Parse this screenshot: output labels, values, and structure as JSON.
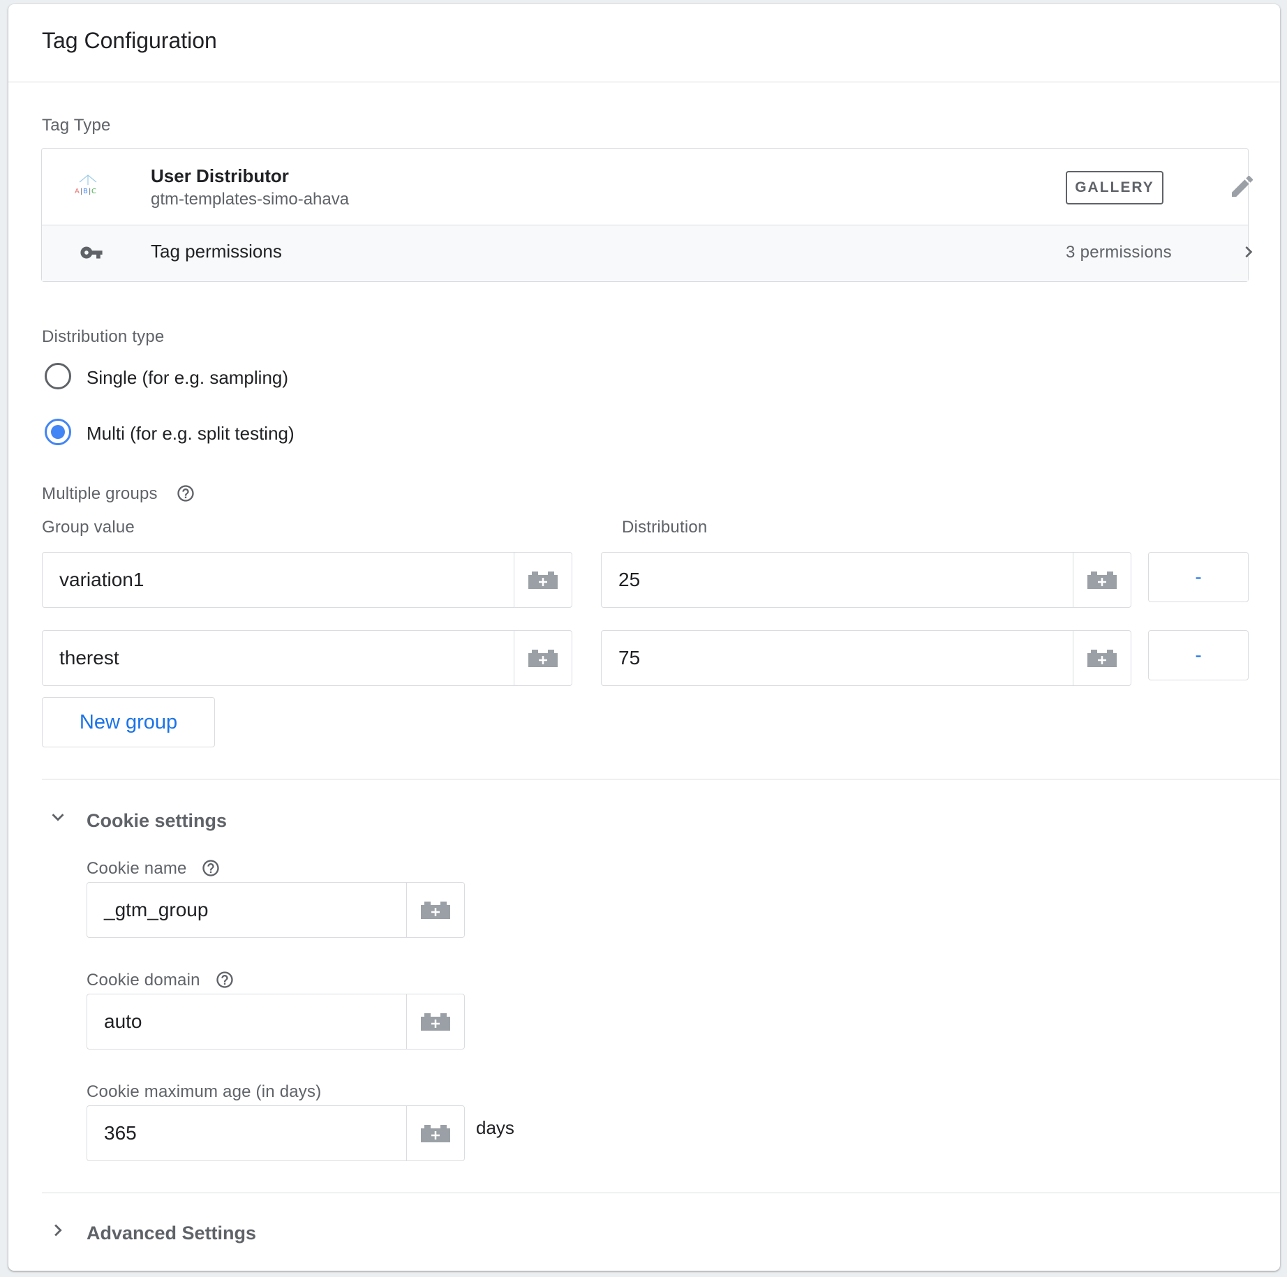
{
  "card": {
    "title": "Tag Configuration"
  },
  "tag_type": {
    "label": "Tag Type",
    "name": "User Distributor",
    "publisher": "gtm-templates-simo-ahava",
    "gallery_label": "GALLERY",
    "logo_text": "A|B|C",
    "permissions_label": "Tag permissions",
    "permissions_count": "3 permissions"
  },
  "distribution": {
    "label": "Distribution type",
    "options": [
      {
        "label": "Single (for e.g. sampling)",
        "selected": false
      },
      {
        "label": "Multi (for e.g. split testing)",
        "selected": true
      }
    ]
  },
  "groups": {
    "label": "Multiple groups",
    "col_value": "Group value",
    "col_distribution": "Distribution",
    "rows": [
      {
        "value": "variation1",
        "distribution": "25",
        "remove_label": "-"
      },
      {
        "value": "therest",
        "distribution": "75",
        "remove_label": "-"
      }
    ],
    "new_group_label": "New group"
  },
  "cookie": {
    "section_title": "Cookie settings",
    "name_label": "Cookie name",
    "name_value": "_gtm_group",
    "domain_label": "Cookie domain",
    "domain_value": "auto",
    "max_age_label": "Cookie maximum age (in days)",
    "max_age_value": "365",
    "max_age_unit": "days"
  },
  "advanced": {
    "section_title": "Advanced Settings"
  },
  "colors": {
    "accent": "#1a73e8",
    "radio": "#4285f4",
    "border": "#dadce0",
    "text": "#202124",
    "muted": "#5f6368"
  }
}
